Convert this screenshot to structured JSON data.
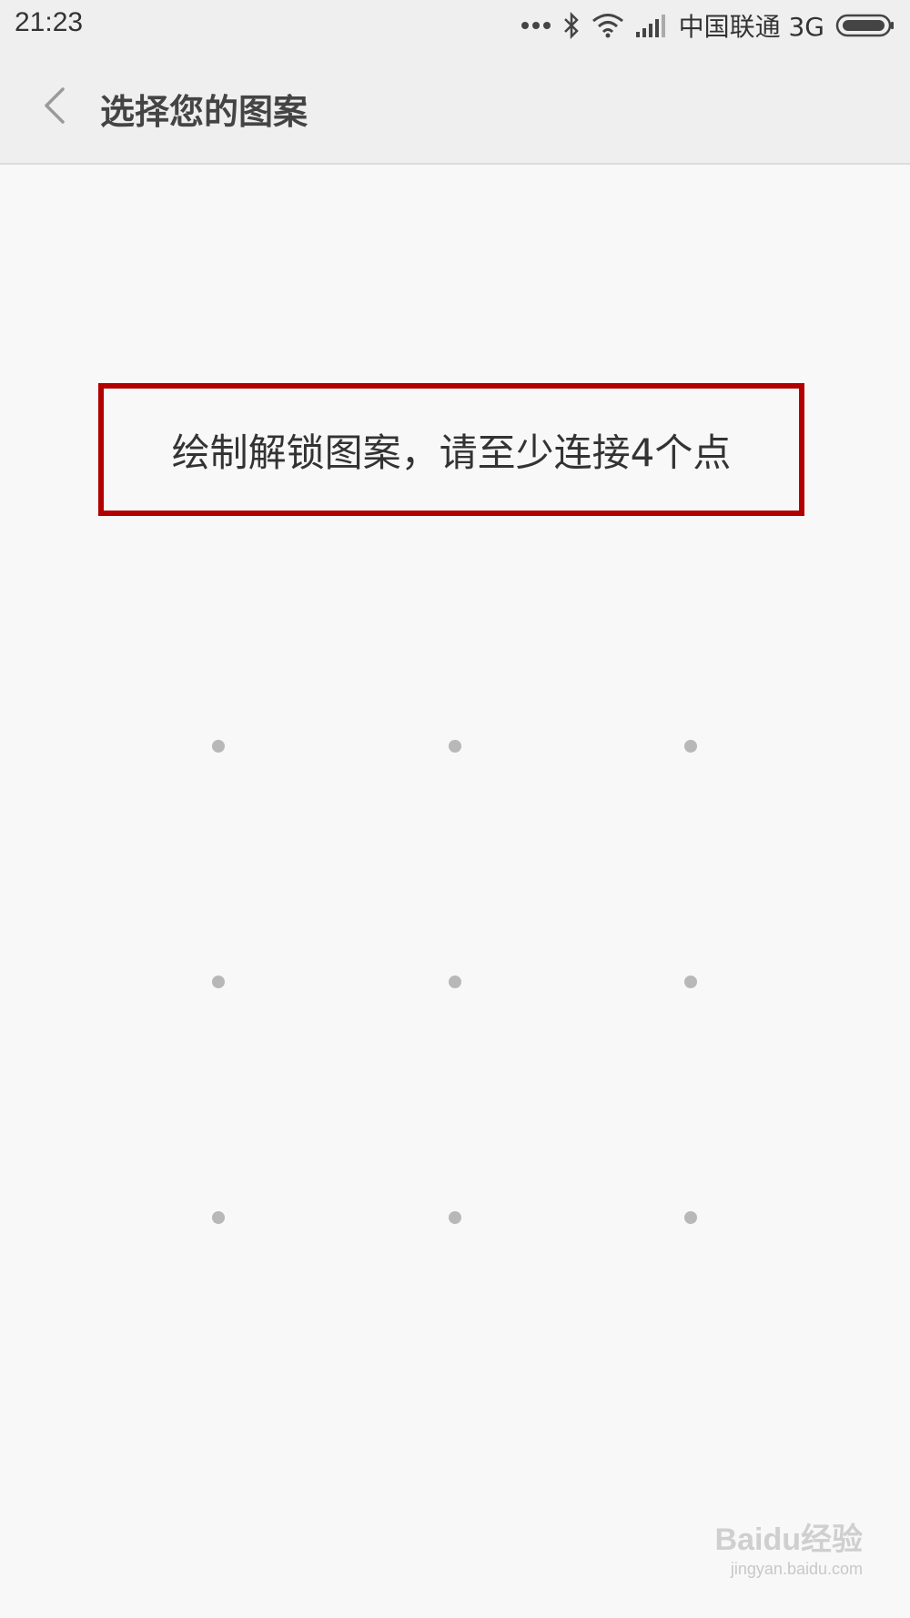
{
  "status_bar": {
    "time": "21:23",
    "carrier": "中国联通 3G",
    "icons": [
      "more-dots-icon",
      "bluetooth-icon",
      "wifi-icon",
      "signal-icon",
      "battery-icon"
    ]
  },
  "header": {
    "back_icon": "chevron-left-icon",
    "title": "选择您的图案"
  },
  "hint": {
    "text": "绘制解锁图案，请至少连接4个点",
    "highlight_color": "#b20000"
  },
  "pattern": {
    "rows": 3,
    "cols": 3,
    "dot_color": "#b8b8b8"
  },
  "watermark": {
    "logo": "Baidu经验",
    "url": "jingyan.baidu.com"
  }
}
